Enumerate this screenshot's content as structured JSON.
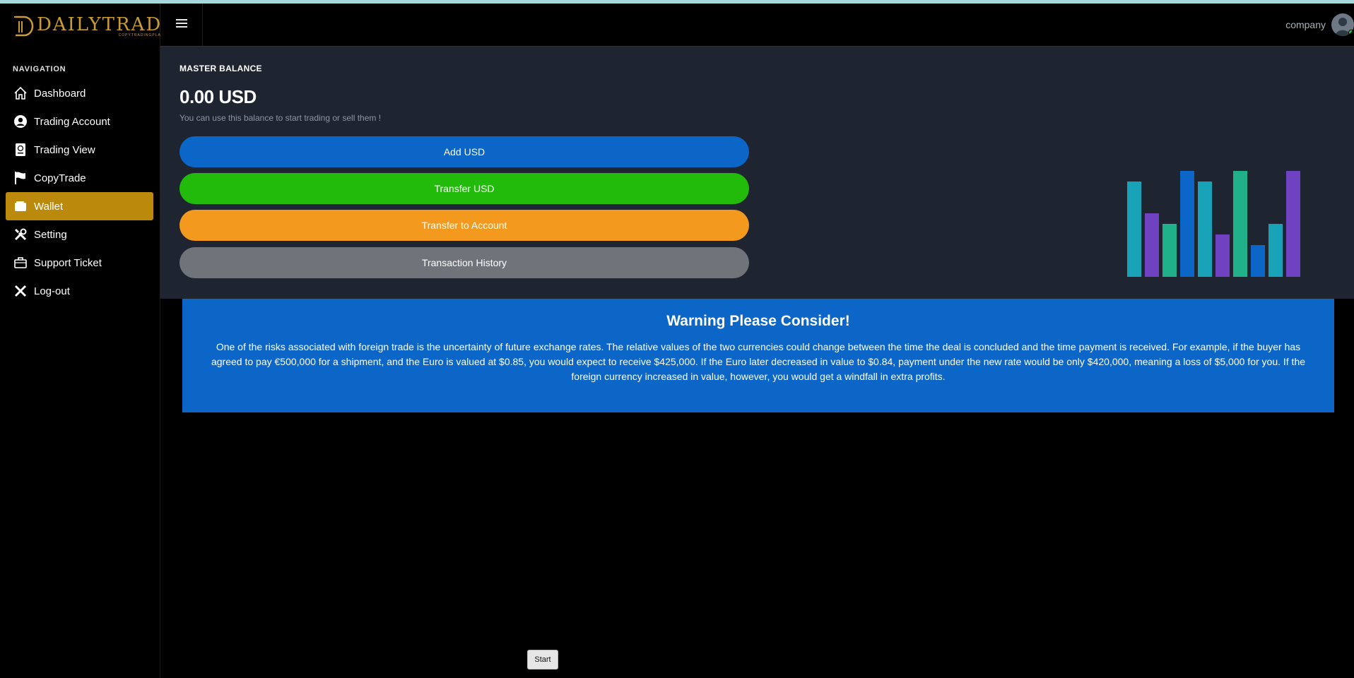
{
  "brand": {
    "name": "DAILYTRADE",
    "tagline": "COPYTRADINGPLATFORM"
  },
  "sidebar": {
    "heading": "NAVIGATION",
    "items": [
      {
        "label": "Dashboard",
        "icon": "home-icon",
        "active": false
      },
      {
        "label": "Trading Account",
        "icon": "user-circle-icon",
        "active": false
      },
      {
        "label": "Trading View",
        "icon": "passport-icon",
        "active": false
      },
      {
        "label": "CopyTrade",
        "icon": "flag-icon",
        "active": false
      },
      {
        "label": "Wallet",
        "icon": "wallet-icon",
        "active": true
      },
      {
        "label": "Setting",
        "icon": "tools-icon",
        "active": false
      },
      {
        "label": "Support Ticket",
        "icon": "briefcase-icon",
        "active": false
      },
      {
        "label": "Log-out",
        "icon": "close-icon",
        "active": false
      }
    ]
  },
  "header": {
    "menu_icon": "hamburger-icon",
    "user_name": "company"
  },
  "balance": {
    "title": "MASTER BALANCE",
    "amount": "0.00 USD",
    "hint": "You can use this balance to start trading or sell them !",
    "buttons": {
      "add": "Add USD",
      "transfer": "Transfer USD",
      "account": "Transfer to Account",
      "history": "Transaction History"
    }
  },
  "decor_bars": [
    {
      "value": 135,
      "color": "#17a2b8"
    },
    {
      "value": 90,
      "color": "#6f42c1"
    },
    {
      "value": 75,
      "color": "#20b08a"
    },
    {
      "value": 150,
      "color": "#0b66c7"
    },
    {
      "value": 135,
      "color": "#17a2b8"
    },
    {
      "value": 60,
      "color": "#6f42c1"
    },
    {
      "value": 150,
      "color": "#20b08a"
    },
    {
      "value": 45,
      "color": "#0b66c7"
    },
    {
      "value": 75,
      "color": "#17a2b8"
    },
    {
      "value": 150,
      "color": "#6f42c1"
    }
  ],
  "warning": {
    "title": "Warning Please Consider!",
    "text": "One of the risks associated with foreign trade is the uncertainty of future exchange rates. The relative values of the two currencies could change between the time the deal is concluded and the time payment is received. For example, if the buyer has agreed to pay €500,000 for a shipment, and the Euro is valued at $0.85, you would expect to receive $425,000. If the Euro later decreased in value to $0.84, payment under the new rate would be only $420,000, meaning a loss of $5,000 for you. If the foreign currency increased in value, however, you would get a windfall in extra profits."
  },
  "start_label": "Start",
  "colors": {
    "accent": "#bb8a0d",
    "panel": "#1e2430",
    "blue": "#0b66c7",
    "green": "#22bb0c",
    "orange": "#f39a1e",
    "gray": "#6f737a"
  }
}
